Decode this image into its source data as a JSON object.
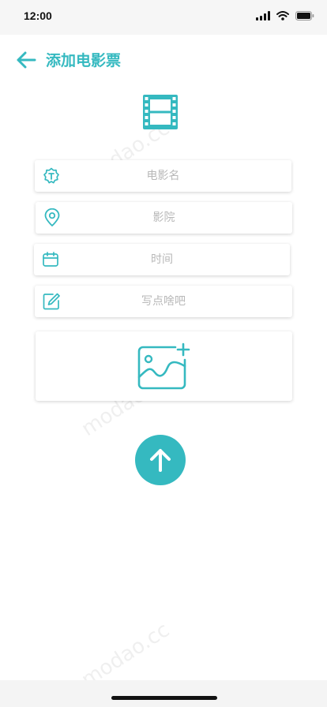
{
  "status_bar": {
    "time": "12:00"
  },
  "header": {
    "title": "添加电影票"
  },
  "form": {
    "movie_name_placeholder": "电影名",
    "cinema_placeholder": "影院",
    "time_placeholder": "时间",
    "note_placeholder": "写点啥吧"
  },
  "watermark": {
    "text": "modao.cc"
  },
  "icons": {
    "back": "arrow-left-icon",
    "film": "film-icon",
    "title_field": "text-badge-icon",
    "location": "location-pin-icon",
    "calendar": "calendar-icon",
    "edit": "edit-icon",
    "add_image": "add-image-icon",
    "submit": "arrow-up-icon"
  },
  "colors": {
    "accent": "#35b9c0",
    "placeholder": "#b8b8b8"
  }
}
